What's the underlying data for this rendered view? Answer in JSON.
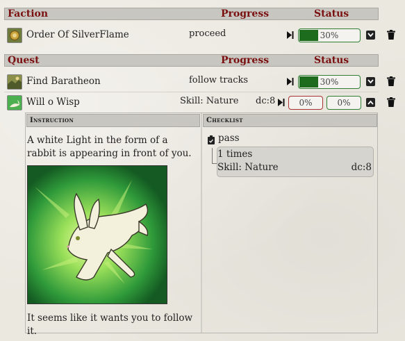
{
  "faction_section": {
    "header_name": "Faction",
    "header_progress": "Progress",
    "header_status": "Status",
    "rows": [
      {
        "name": "Order Of SilverFlame",
        "progress": "proceed",
        "status_percent": 30,
        "status_text": "30%"
      }
    ]
  },
  "quest_section": {
    "header_name": "Quest",
    "header_progress": "Progress",
    "header_status": "Status",
    "rows": [
      {
        "name": "Find Baratheon",
        "progress": "follow tracks",
        "status_percent": 30,
        "status_text": "30%"
      },
      {
        "name": "Will o Wisp",
        "progress": "Skill: Nature",
        "dc": "dc:8",
        "status_left_text": "0%",
        "status_right_text": "0%"
      }
    ]
  },
  "detail": {
    "instruction_header": "Instruction",
    "checklist_header": "Checklist",
    "instruction_text_1": "A white Light in the form of a rabbit is appearing in front of you.",
    "instruction_text_2": "It seems like it wants you to follow it.",
    "checklist_item": "pass",
    "checklist_times": "1 times",
    "checklist_skill": "Skill: Nature",
    "checklist_dc": "dc:8"
  },
  "colors": {
    "header_text": "#7a1010",
    "progress_green": "#1d6b1d",
    "bar_green_border": "#2e7d32",
    "bar_red_border": "#a83232"
  }
}
